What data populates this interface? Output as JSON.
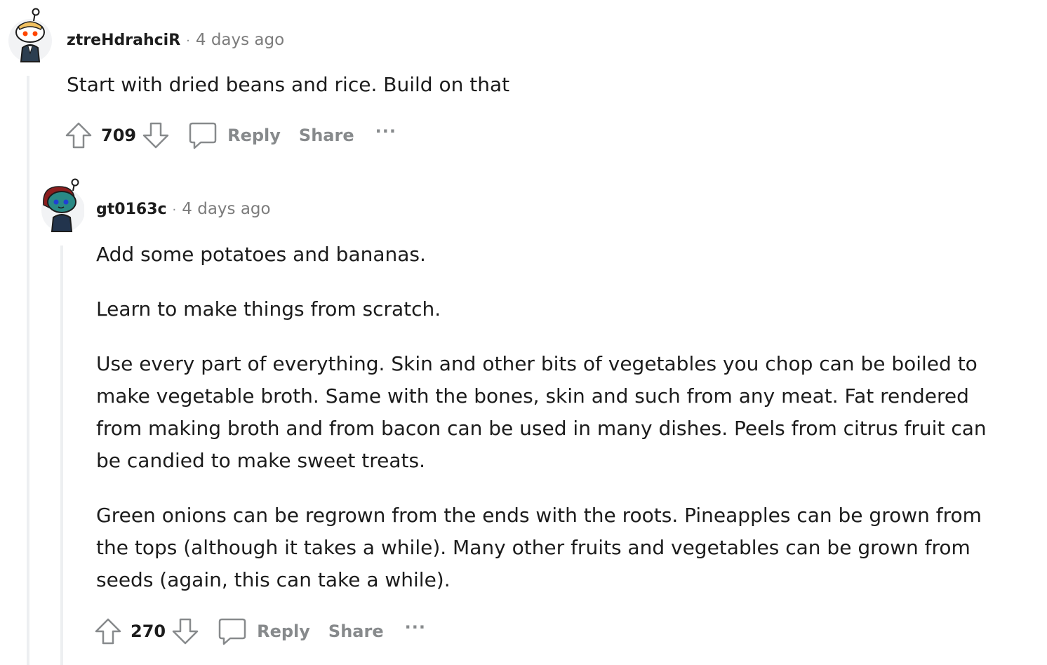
{
  "comments": [
    {
      "author": "ztreHdrahciR",
      "time": "4 days ago",
      "separator": "·",
      "paragraphs": [
        "Start with dried beans and rice. Build on that"
      ],
      "score": "709",
      "reply_label": "Reply",
      "share_label": "Share",
      "more_label": "···"
    },
    {
      "author": "gt0163c",
      "time": "4 days ago",
      "separator": "·",
      "paragraphs": [
        "Add some potatoes and bananas.",
        "Learn to make things from scratch.",
        "Use every part of everything. Skin and other bits of vegetables you chop can be boiled to make vegetable broth. Same with the bones, skin and such from any meat. Fat rendered from making broth and from bacon can be used in many dishes. Peels from citrus fruit can be candied to make sweet treats.",
        "Green onions can be regrown from the ends with the roots. Pineapples can be grown from the tops (although it takes a while). Many other fruits and vegetables can be grown from seeds (again, this can take a while)."
      ],
      "score": "270",
      "reply_label": "Reply",
      "share_label": "Share",
      "more_label": "···"
    }
  ]
}
